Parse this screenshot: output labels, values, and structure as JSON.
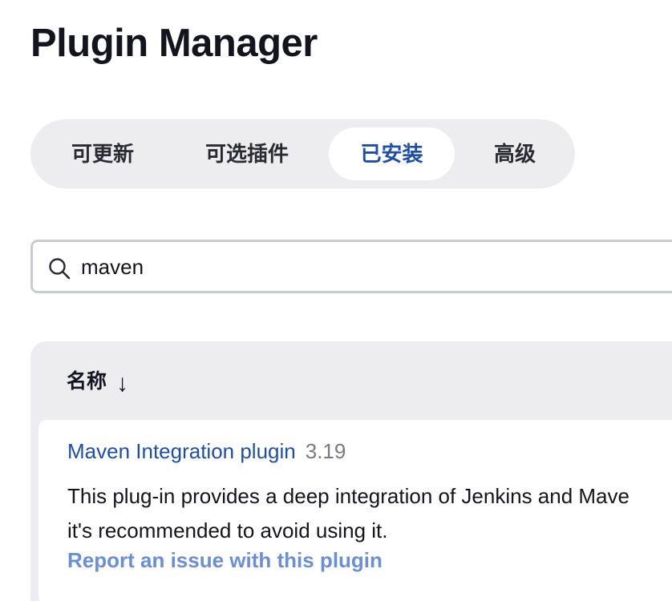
{
  "page": {
    "title": "Plugin Manager"
  },
  "tabs": [
    {
      "label": "可更新",
      "active": false
    },
    {
      "label": "可选插件",
      "active": false
    },
    {
      "label": "已安装",
      "active": true
    },
    {
      "label": "高级",
      "active": false
    }
  ],
  "search": {
    "value": "maven",
    "icon": "search-icon"
  },
  "table": {
    "column_header": "名称",
    "sort_indicator": "↓",
    "rows": [
      {
        "name": "Maven Integration plugin",
        "version": "3.19",
        "description_line1": "This plug-in provides a deep integration of Jenkins and Mave",
        "description_line2": "it's recommended to avoid using it.",
        "report_link": "Report an issue with this plugin"
      }
    ]
  },
  "colors": {
    "accent": "#1e4fa8",
    "tab_bar_bg": "#ededf0",
    "report_link": "#6a8fd6",
    "version_text": "#7a7a85"
  }
}
